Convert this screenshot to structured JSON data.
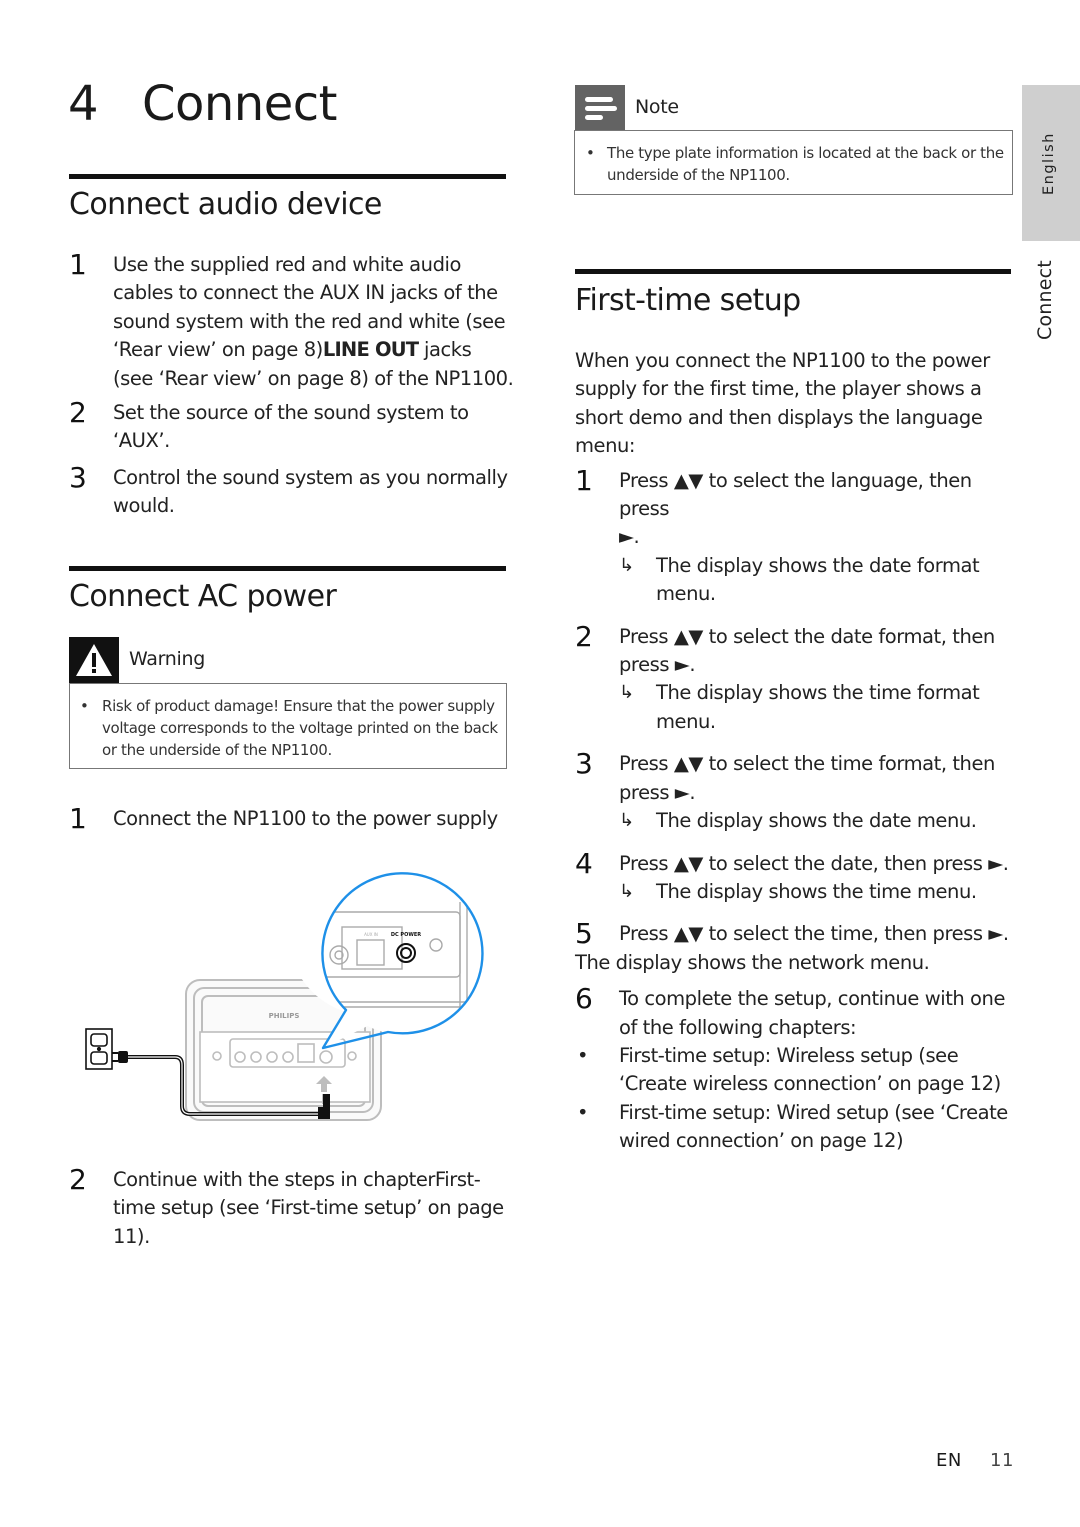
{
  "chapter": {
    "number": "4",
    "title": "Connect"
  },
  "side_tabs": {
    "language": "English",
    "section": "Connect"
  },
  "connect_audio": {
    "heading": "Connect audio device",
    "steps": [
      {
        "num": "1",
        "lines": [
          "Use the supplied red and white audio",
          "cables to connect the AUX IN jacks of the",
          "sound system with the red and white  (see",
          "‘Rear view’ on page 8)"
        ],
        "bold": "LINE OUT",
        "after_bold": " jacks",
        "last_line": "(see ‘Rear view’ on page 8) of the NP1100."
      },
      {
        "num": "2",
        "lines": [
          "Set the source of the sound system to",
          "‘AUX’."
        ]
      },
      {
        "num": "3",
        "lines": [
          "Control the sound system as you normally",
          "would."
        ]
      }
    ]
  },
  "connect_ac": {
    "heading": "Connect AC power",
    "warning": {
      "icon": "warning-triangle-icon",
      "label": "Warning",
      "bullet": "•",
      "lines": [
        "Risk of product damage! Ensure that the power supply",
        "voltage corresponds to the voltage printed on the back",
        "or the underside of the NP1100."
      ]
    },
    "step1": {
      "num": "1",
      "text": "Connect the NP1100 to the power supply"
    },
    "diagram": {
      "brand_label": "PHILIPS",
      "zoom_jack_label": "DC POWER",
      "zoom_slot_label": "AUX IN"
    },
    "step2": {
      "num": "2",
      "lines": [
        "Continue with the steps in chapterFirst-",
        "time setup (see ‘First-time setup’ on page",
        "11)."
      ]
    }
  },
  "note": {
    "icon": "note-lines-icon",
    "label": "Note",
    "bullet": "•",
    "lines": [
      "The type plate information is located at the back or the",
      "underside of the NP1100."
    ]
  },
  "first_time_setup": {
    "heading": "First-time setup",
    "intro": [
      "When you connect the NP1100 to the power",
      "supply for the first time, the player shows a",
      "short demo and then displays the language",
      "menu:"
    ],
    "result_arrow": "↳",
    "steps": [
      {
        "num": "1",
        "lines": [
          "Press ▲▼ to select the language, then press",
          "►."
        ],
        "result": [
          "The display shows the date format",
          "menu."
        ]
      },
      {
        "num": "2",
        "lines": [
          "Press ▲▼ to select the date format, then",
          "press ►."
        ],
        "result": [
          "The display shows the time format",
          "menu."
        ]
      },
      {
        "num": "3",
        "lines": [
          "Press ▲▼ to select the time format, then",
          "press ►."
        ],
        "result": [
          "The display shows the date menu."
        ]
      },
      {
        "num": "4",
        "lines": [
          "Press ▲▼ to select the date, then press ►."
        ],
        "result": [
          "The display shows the time menu."
        ]
      },
      {
        "num": "5",
        "lines": [
          "Press ▲▼ to select the time, then press ►."
        ]
      }
    ],
    "after_step5": "The display shows the network menu.",
    "step6": {
      "num": "6",
      "lines": [
        "To complete the setup, continue with one",
        "of the following chapters:"
      ]
    },
    "bullets": [
      [
        "First-time setup: Wireless setup (see",
        "‘Create wireless connection’ on page 12)"
      ],
      [
        "First-time setup: Wired setup (see ‘Create",
        "wired connection’ on page 12)"
      ]
    ],
    "bullet_char": "•"
  },
  "footer": {
    "lang": "EN",
    "page": "11"
  }
}
